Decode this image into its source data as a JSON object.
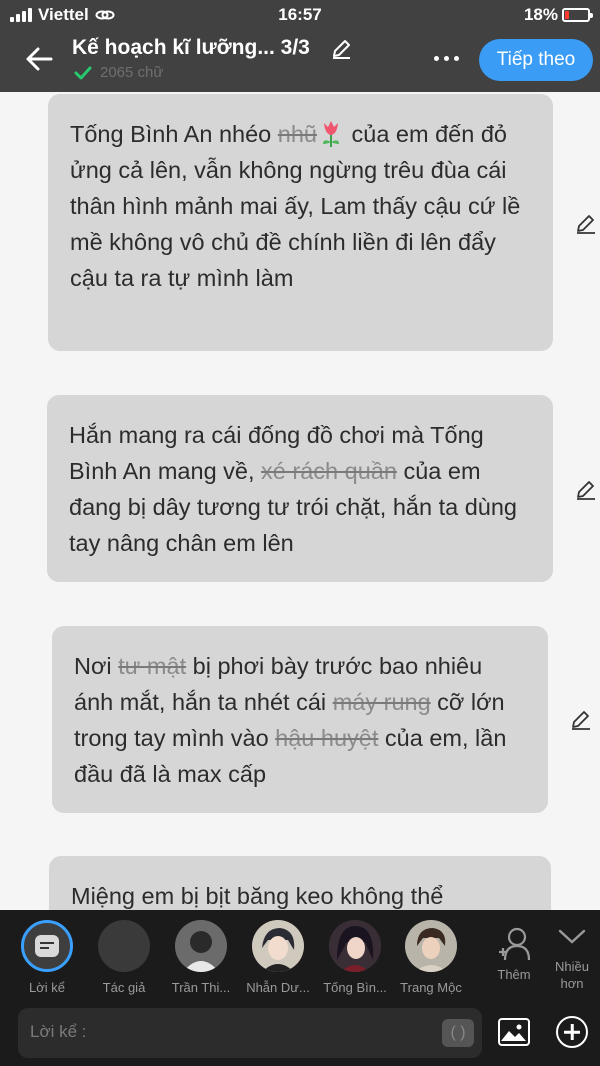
{
  "status_bar": {
    "carrier": "Viettel",
    "time": "16:57",
    "battery": "18%",
    "battery_level": 0.18
  },
  "header": {
    "title": "Kế hoạch kĩ lưỡng... 3/3",
    "word_count": "2065 chữ",
    "next_label": "Tiếp theo"
  },
  "paragraphs": [
    {
      "parts": [
        {
          "text": "Tống Bình An nhéo "
        },
        {
          "text": "nhũ",
          "style": "blur"
        },
        {
          "icon": "tulip-icon"
        },
        {
          "text": " của em đến đỏ ửng cả lên, vẫn không ngừng trêu đùa cái thân hình mảnh mai ấy, Lam thấy cậu cứ lề mề không vô chủ đề chính liền đi lên đẩy cậu ta ra tự mình làm"
        }
      ]
    },
    {
      "parts": [
        {
          "text": "Hắn mang ra cái đống đồ chơi mà Tống Bình An mang về, "
        },
        {
          "text": "xé rách quần",
          "style": "blur"
        },
        {
          "text": " của em đang bị dây tương tư trói chặt, hắn ta dùng tay nâng chân em lên"
        }
      ]
    },
    {
      "parts": [
        {
          "text": "Nơi "
        },
        {
          "text": "tư mật",
          "style": "blur"
        },
        {
          "text": " bị phơi bày trước bao nhiêu ánh mắt, hắn ta nhét cái "
        },
        {
          "text": "máy rung",
          "style": "blur"
        },
        {
          "text": " cỡ lớn trong tay mình vào "
        },
        {
          "text": "hậu huyệt",
          "style": "blur"
        },
        {
          "text": " của em, lần đầu đã là max cấp"
        }
      ]
    },
    {
      "parts": [
        {
          "text": "Miệng em bị bịt băng keo không thể"
        }
      ]
    }
  ],
  "characters": [
    {
      "name": "Lời kể",
      "selected": true,
      "icon": "narrator-icon"
    },
    {
      "name": "Tác giả",
      "selected": false
    },
    {
      "name": "Trần Thi...",
      "selected": false
    },
    {
      "name": "Nhẫn Dư...",
      "selected": false
    },
    {
      "name": "Tống Bìn...",
      "selected": false
    },
    {
      "name": "Trang Mộc",
      "selected": false
    }
  ],
  "more_button": {
    "label": "Thêm"
  },
  "collapse_button": {
    "label_line1": "Nhiều",
    "label_line2": "hơn"
  },
  "input": {
    "placeholder": "Lời kể :",
    "paren_label": "( )"
  }
}
